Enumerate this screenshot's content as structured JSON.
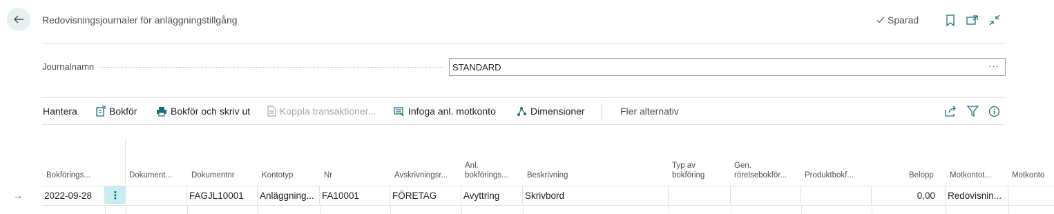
{
  "header": {
    "back_label": "Tillbaka",
    "title": "Redovisningsjournaler för anläggningstillgång",
    "saved_label": "Sparad"
  },
  "journal": {
    "label": "Journalnamn",
    "value": "STANDARD",
    "ellipsis": "···"
  },
  "actions": {
    "manage": "Hantera",
    "post": "Bokför",
    "post_print": "Bokför och skriv ut",
    "match": "Koppla transaktioner...",
    "insert_bal": "Infoga anl. motkonto",
    "dimensions": "Dimensioner",
    "more": "Fler alternativ"
  },
  "table": {
    "headers": {
      "posting_date": "Bokförings...",
      "doc_type": "Dokument...",
      "doc_no": "Dokumentnr",
      "account_type": "Kontotyp",
      "no": "Nr",
      "depr_book": "Avskrivningsr...",
      "fa_posting_1": "Anl.",
      "fa_posting_2": "bokförings...",
      "description": "Beskrivning",
      "gen_type_1": "Typ av",
      "gen_type_2": "bokföring",
      "gen_bus_1": "Gen.",
      "gen_bus_2": "rörelsebokför...",
      "gen_prod": "Produktbokf...",
      "amount": "Belopp",
      "bal_type": "Motkontot...",
      "bal_acc": "Motkonto"
    },
    "row": {
      "arrow": "→",
      "menu": "⋮",
      "posting_date": "2022-09-28",
      "doc_type": "",
      "doc_no": "FAGJL10001",
      "account_type": "Anläggning...",
      "no": "FA10001",
      "depr_book": "FÖRETAG",
      "fa_posting": "Avyttring",
      "description": "Skrivbord",
      "gen_type": "",
      "gen_bus": "",
      "gen_prod": "",
      "amount": "0,00",
      "bal_type": "Redovisnin...",
      "bal_acc": ""
    }
  }
}
